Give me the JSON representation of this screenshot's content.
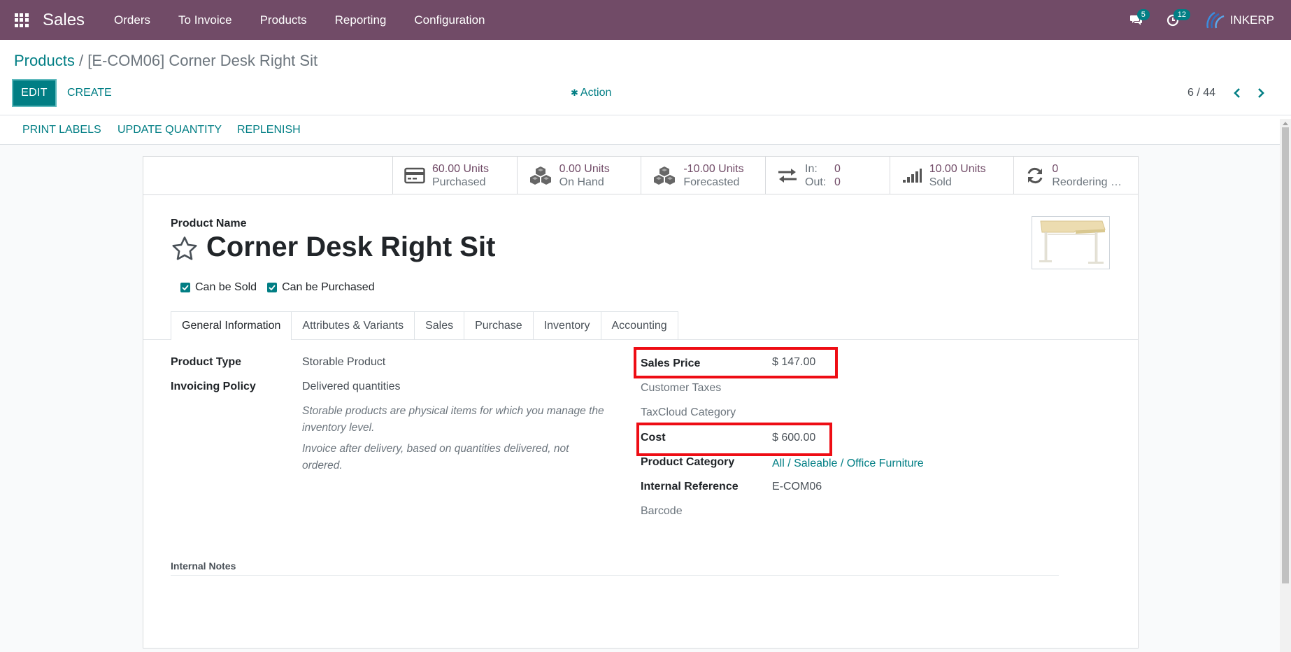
{
  "navbar": {
    "brand": "Sales",
    "menu": [
      "Orders",
      "To Invoice",
      "Products",
      "Reporting",
      "Configuration"
    ],
    "messages_count": "5",
    "activities_count": "12",
    "company": "INKERP"
  },
  "breadcrumb": {
    "parent": "Products",
    "separator": "/",
    "current": "[E-COM06] Corner Desk Right Sit"
  },
  "control": {
    "edit_label": "EDIT",
    "create_label": "CREATE",
    "action_label": "Action",
    "pager_value": "6 / 44"
  },
  "statusbar": {
    "print_labels": "PRINT LABELS",
    "update_quantity": "UPDATE QUANTITY",
    "replenish": "REPLENISH"
  },
  "smart_buttons": {
    "purchased": {
      "value": "60.00 Units",
      "label": "Purchased",
      "icon": "credit-card-icon"
    },
    "on_hand": {
      "value": "0.00 Units",
      "label": "On Hand",
      "icon": "cubes-icon"
    },
    "forecasted": {
      "value": "-10.00 Units",
      "label": "Forecasted",
      "icon": "cubes-icon"
    },
    "in_out": {
      "in_label": "In:",
      "in_value": "0",
      "out_label": "Out:",
      "out_value": "0",
      "icon": "exchange-icon"
    },
    "sold": {
      "value": "10.00 Units",
      "label": "Sold",
      "icon": "signal-icon"
    },
    "reordering": {
      "value": "0",
      "label": "Reordering R...",
      "icon": "refresh-icon"
    }
  },
  "product": {
    "name_label": "Product Name",
    "name": "Corner Desk Right Sit",
    "can_be_sold_label": "Can be Sold",
    "can_be_purchased_label": "Can be Purchased",
    "can_be_sold": true,
    "can_be_purchased": true
  },
  "tabs": [
    "General Information",
    "Attributes & Variants",
    "Sales",
    "Purchase",
    "Inventory",
    "Accounting"
  ],
  "general": {
    "product_type_label": "Product Type",
    "product_type": "Storable Product",
    "invoicing_policy_label": "Invoicing Policy",
    "invoicing_policy": "Delivered quantities",
    "help_type": "Storable products are physical items for which you manage the inventory level.",
    "help_invoice": "Invoice after delivery, based on quantities delivered, not ordered.",
    "sales_price_label": "Sales Price",
    "sales_price": "$ 147.00",
    "customer_taxes_label": "Customer Taxes",
    "taxcloud_label": "TaxCloud Category",
    "cost_label": "Cost",
    "cost": "$ 600.00",
    "product_category_label": "Product Category",
    "product_category": "All / Saleable / Office Furniture",
    "internal_reference_label": "Internal Reference",
    "internal_reference": "E-COM06",
    "barcode_label": "Barcode",
    "internal_notes_label": "Internal Notes"
  },
  "colors": {
    "navbar": "#714b67",
    "accent": "#017e84",
    "highlight": "#ee0d14"
  }
}
